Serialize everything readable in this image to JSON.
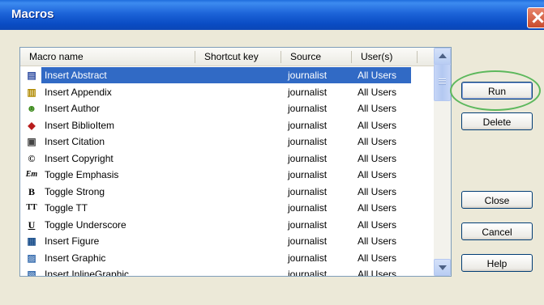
{
  "window": {
    "title": "Macros"
  },
  "columns": [
    "Macro name",
    "Shortcut key",
    "Source",
    "User(s)"
  ],
  "macros": [
    {
      "name": "Insert Abstract",
      "shortcut": "",
      "source": "journalist",
      "users": "All Users",
      "icon": "abstract-icon",
      "glyph": "▤",
      "color": "#2c4aa0",
      "selected": true
    },
    {
      "name": "Insert Appendix",
      "shortcut": "",
      "source": "journalist",
      "users": "All Users",
      "icon": "appendix-icon",
      "glyph": "▥",
      "color": "#b08a00",
      "selected": false
    },
    {
      "name": "Insert Author",
      "shortcut": "",
      "source": "journalist",
      "users": "All Users",
      "icon": "author-icon",
      "glyph": "☻",
      "color": "#3c8a1c",
      "selected": false
    },
    {
      "name": "Insert BiblioItem",
      "shortcut": "",
      "source": "journalist",
      "users": "All Users",
      "icon": "biblio-book-icon",
      "glyph": "◆",
      "color": "#b81c1c",
      "selected": false
    },
    {
      "name": "Insert Citation",
      "shortcut": "",
      "source": "journalist",
      "users": "All Users",
      "icon": "citation-icon",
      "glyph": "▣",
      "color": "#444444",
      "selected": false
    },
    {
      "name": "Insert Copyright",
      "shortcut": "",
      "source": "journalist",
      "users": "All Users",
      "icon": "copyright-icon",
      "glyph": "©",
      "color": "#000000",
      "selected": false
    },
    {
      "name": "Toggle Emphasis",
      "shortcut": "",
      "source": "journalist",
      "users": "All Users",
      "icon": "emphasis-icon",
      "glyph": "Em",
      "color": "#000000",
      "selected": false
    },
    {
      "name": "Toggle Strong",
      "shortcut": "",
      "source": "journalist",
      "users": "All Users",
      "icon": "strong-icon",
      "glyph": "B",
      "color": "#000000",
      "selected": false
    },
    {
      "name": "Toggle TT",
      "shortcut": "",
      "source": "journalist",
      "users": "All Users",
      "icon": "teletype-icon",
      "glyph": "TT",
      "color": "#000000",
      "selected": false
    },
    {
      "name": "Toggle Underscore",
      "shortcut": "",
      "source": "journalist",
      "users": "All Users",
      "icon": "underscore-icon",
      "glyph": "U",
      "color": "#000000",
      "selected": false
    },
    {
      "name": "Insert Figure",
      "shortcut": "",
      "source": "journalist",
      "users": "All Users",
      "icon": "figure-icon",
      "glyph": "▦",
      "color": "#1a4f8c",
      "selected": false
    },
    {
      "name": "Insert Graphic",
      "shortcut": "",
      "source": "journalist",
      "users": "All Users",
      "icon": "graphic-icon",
      "glyph": "▨",
      "color": "#3a6fb0",
      "selected": false
    },
    {
      "name": "Insert InlineGraphic",
      "shortcut": "",
      "source": "journalist",
      "users": "All Users",
      "icon": "inline-graphic-icon",
      "glyph": "▧",
      "color": "#3a6fb0",
      "selected": false
    }
  ],
  "buttons": {
    "run": "Run",
    "delete": "Delete",
    "close": "Close",
    "cancel": "Cancel",
    "help": "Help"
  },
  "colors": {
    "selection": "#316ac5",
    "titlebar": "#0a4cc4",
    "highlight_ring": "#5cb85c"
  }
}
